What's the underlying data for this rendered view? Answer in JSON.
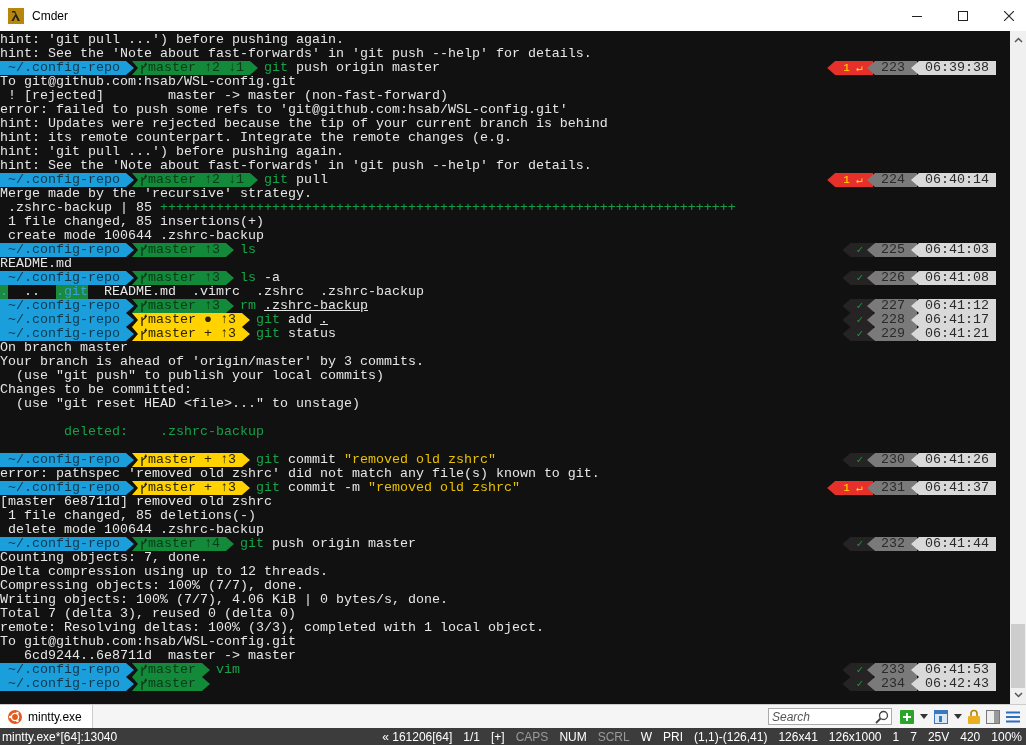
{
  "window": {
    "title": "Cmder"
  },
  "terminal": {
    "lines": [
      {
        "kind": "text",
        "parts": [
          {
            "text": "hint: 'git pull ...') before pushing again."
          }
        ]
      },
      {
        "kind": "text",
        "parts": [
          {
            "text": "hint: See the 'Note about fast-forwards' in 'git push --help' for details."
          }
        ]
      },
      {
        "kind": "prompt",
        "path": "~/.config-repo",
        "branch": "master ↑2 ↓1",
        "dirty": false,
        "command": [
          {
            "text": "git",
            "kind": "program"
          },
          {
            "text": "push origin master"
          }
        ],
        "status": {
          "kind": "error",
          "text": "1 ↵"
        },
        "number": "223",
        "time": "06:39:38"
      },
      {
        "kind": "text",
        "parts": [
          {
            "text": "To git@github.com:hsab/WSL-config.git"
          }
        ]
      },
      {
        "kind": "text",
        "parts": [
          {
            "text": " ! [rejected]        master -> master (non-fast-forward)"
          }
        ]
      },
      {
        "kind": "text",
        "parts": [
          {
            "text": "error: failed to push some refs to 'git@github.com:hsab/WSL-config.git'"
          }
        ]
      },
      {
        "kind": "text",
        "parts": [
          {
            "text": "hint: Updates were rejected because the tip of your current branch is behind"
          }
        ]
      },
      {
        "kind": "text",
        "parts": [
          {
            "text": "hint: its remote counterpart. Integrate the remote changes (e.g."
          }
        ]
      },
      {
        "kind": "text",
        "parts": [
          {
            "text": "hint: 'git pull ...') before pushing again."
          }
        ]
      },
      {
        "kind": "text",
        "parts": [
          {
            "text": "hint: See the 'Note about fast-forwards' in 'git push --help' for details."
          }
        ]
      },
      {
        "kind": "prompt",
        "path": "~/.config-repo",
        "branch": "master ↑2 ↓1",
        "dirty": false,
        "command": [
          {
            "text": "git",
            "kind": "program"
          },
          {
            "text": "pull"
          }
        ],
        "status": {
          "kind": "error",
          "text": "1 ↵"
        },
        "number": "224",
        "time": "06:40:14"
      },
      {
        "kind": "text",
        "parts": [
          {
            "text": "Merge made by the 'recursive' strategy."
          }
        ]
      },
      {
        "kind": "text",
        "parts": [
          {
            "text": " .zshrc-backup | 85 "
          },
          {
            "text": "++++++++++++++++++++++++++++++++++++++++++++++++++++++++++++++++++++++++",
            "kind": "added"
          }
        ]
      },
      {
        "kind": "text",
        "parts": [
          {
            "text": " 1 file changed, 85 insertions(+)"
          }
        ]
      },
      {
        "kind": "text",
        "parts": [
          {
            "text": " create mode 100644 .zshrc-backup"
          }
        ]
      },
      {
        "kind": "prompt",
        "path": "~/.config-repo",
        "branch": "master ↑3",
        "dirty": false,
        "command": [
          {
            "text": "ls",
            "kind": "program"
          }
        ],
        "status": {
          "kind": "ok",
          "text": "✓"
        },
        "number": "225",
        "time": "06:41:03"
      },
      {
        "kind": "text",
        "parts": [
          {
            "text": "README.md"
          }
        ]
      },
      {
        "kind": "prompt",
        "path": "~/.config-repo",
        "branch": "master ↑3",
        "dirty": false,
        "command": [
          {
            "text": "ls",
            "kind": "program"
          },
          {
            "text": "-a"
          }
        ],
        "status": {
          "kind": "ok",
          "text": "✓"
        },
        "number": "226",
        "time": "06:41:08"
      },
      {
        "kind": "text",
        "parts": [
          {
            "text": ".",
            "kind": "directory"
          },
          {
            "text": "  ..  "
          },
          {
            "text": ".git",
            "kind": "directory"
          },
          {
            "text": "  README.md  .vimrc  .zshrc  .zshrc-backup"
          }
        ]
      },
      {
        "kind": "prompt",
        "path": "~/.config-repo",
        "branch": "master ↑3",
        "dirty": false,
        "command": [
          {
            "text": "rm",
            "kind": "program"
          },
          {
            "text": ".zshrc-backup",
            "kind": "path"
          }
        ],
        "status": {
          "kind": "ok",
          "text": "✓"
        },
        "number": "227",
        "time": "06:41:12"
      },
      {
        "kind": "prompt",
        "path": "~/.config-repo",
        "branch": "master ● ↑3",
        "dirty": true,
        "command": [
          {
            "text": "git",
            "kind": "program"
          },
          {
            "text": "add "
          },
          {
            "text": ".",
            "kind": "path"
          }
        ],
        "status": {
          "kind": "ok",
          "text": "✓"
        },
        "number": "228",
        "time": "06:41:17"
      },
      {
        "kind": "prompt",
        "path": "~/.config-repo",
        "branch": "master + ↑3",
        "dirty": true,
        "command": [
          {
            "text": "git",
            "kind": "program"
          },
          {
            "text": "status"
          }
        ],
        "status": {
          "kind": "ok",
          "text": "✓"
        },
        "number": "229",
        "time": "06:41:21"
      },
      {
        "kind": "text",
        "parts": [
          {
            "text": "On branch master"
          }
        ]
      },
      {
        "kind": "text",
        "parts": [
          {
            "text": "Your branch is ahead of 'origin/master' by 3 commits."
          }
        ]
      },
      {
        "kind": "text",
        "parts": [
          {
            "text": "  (use \"git push\" to publish your local commits)"
          }
        ]
      },
      {
        "kind": "text",
        "parts": [
          {
            "text": "Changes to be committed:"
          }
        ]
      },
      {
        "kind": "text",
        "parts": [
          {
            "text": "  (use \"git reset HEAD <file>...\" to unstage)"
          }
        ]
      },
      {
        "kind": "blank"
      },
      {
        "kind": "text",
        "parts": [
          {
            "text": "        deleted:    .zshrc-backup",
            "kind": "added"
          }
        ]
      },
      {
        "kind": "blank"
      },
      {
        "kind": "prompt",
        "path": "~/.config-repo",
        "branch": "master + ↑3",
        "dirty": true,
        "command": [
          {
            "text": "git",
            "kind": "program"
          },
          {
            "text": "commit "
          },
          {
            "text": "\"removed old zshrc\"",
            "kind": "quoted"
          }
        ],
        "status": {
          "kind": "ok",
          "text": "✓"
        },
        "number": "230",
        "time": "06:41:26"
      },
      {
        "kind": "text",
        "parts": [
          {
            "text": "error: pathspec 'removed old zshrc' did not match any file(s) known to git."
          }
        ]
      },
      {
        "kind": "prompt",
        "path": "~/.config-repo",
        "branch": "master + ↑3",
        "dirty": true,
        "command": [
          {
            "text": "git",
            "kind": "program"
          },
          {
            "text": "commit -m "
          },
          {
            "text": "\"removed old zshrc\"",
            "kind": "quoted"
          }
        ],
        "status": {
          "kind": "error",
          "text": "1 ↵"
        },
        "number": "231",
        "time": "06:41:37"
      },
      {
        "kind": "text",
        "parts": [
          {
            "text": "[master 6e8711d] removed old zshrc"
          }
        ]
      },
      {
        "kind": "text",
        "parts": [
          {
            "text": " 1 file changed, 85 deletions(-)"
          }
        ]
      },
      {
        "kind": "text",
        "parts": [
          {
            "text": " delete mode 100644 .zshrc-backup"
          }
        ]
      },
      {
        "kind": "prompt",
        "path": "~/.config-repo",
        "branch": "master ↑4",
        "dirty": false,
        "command": [
          {
            "text": "git",
            "kind": "program"
          },
          {
            "text": "push origin master"
          }
        ],
        "status": {
          "kind": "ok",
          "text": "✓"
        },
        "number": "232",
        "time": "06:41:44"
      },
      {
        "kind": "text",
        "parts": [
          {
            "text": "Counting objects: 7, done."
          }
        ]
      },
      {
        "kind": "text",
        "parts": [
          {
            "text": "Delta compression using up to 12 threads."
          }
        ]
      },
      {
        "kind": "text",
        "parts": [
          {
            "text": "Compressing objects: 100% (7/7), done."
          }
        ]
      },
      {
        "kind": "text",
        "parts": [
          {
            "text": "Writing objects: 100% (7/7), 4.06 KiB | 0 bytes/s, done."
          }
        ]
      },
      {
        "kind": "text",
        "parts": [
          {
            "text": "Total 7 (delta 3), reused 0 (delta 0)"
          }
        ]
      },
      {
        "kind": "text",
        "parts": [
          {
            "text": "remote: Resolving deltas: 100% (3/3), completed with 1 local object."
          }
        ]
      },
      {
        "kind": "text",
        "parts": [
          {
            "text": "To git@github.com:hsab/WSL-config.git"
          }
        ]
      },
      {
        "kind": "text",
        "parts": [
          {
            "text": "   6cd9244..6e8711d  master -> master"
          }
        ]
      },
      {
        "kind": "prompt",
        "path": "~/.config-repo",
        "branch": "master",
        "dirty": false,
        "command": [
          {
            "text": "vim",
            "kind": "program"
          }
        ],
        "status": {
          "kind": "ok",
          "text": "✓"
        },
        "number": "233",
        "time": "06:41:53"
      },
      {
        "kind": "prompt",
        "path": "~/.config-repo",
        "branch": "master",
        "dirty": false,
        "status": {
          "kind": "ok",
          "text": "✓"
        },
        "number": "234",
        "time": "06:42:43"
      }
    ]
  },
  "tabs": [
    {
      "label": "mintty.exe",
      "selected": true
    }
  ],
  "search": {
    "placeholder": "Search"
  },
  "status_bar": {
    "process": "mintty.exe*[64]:13040",
    "items": [
      {
        "text": "« 161206[64]",
        "disabled": false
      },
      {
        "text": "1/1",
        "disabled": false
      },
      {
        "text": "[+]",
        "disabled": false
      },
      {
        "text": "CAPS",
        "disabled": true
      },
      {
        "text": "NUM",
        "disabled": false
      },
      {
        "text": "SCRL",
        "disabled": true
      },
      {
        "text": "W",
        "disabled": false
      },
      {
        "text": "PRI",
        "disabled": false
      },
      {
        "text": "(1,1)-(126,41)",
        "disabled": false
      },
      {
        "text": "126x41",
        "disabled": false
      },
      {
        "text": "126x1000",
        "disabled": false
      },
      {
        "text": "1",
        "disabled": false
      },
      {
        "text": "7",
        "disabled": false
      },
      {
        "text": "25V",
        "disabled": false
      },
      {
        "text": "420",
        "disabled": false
      },
      {
        "text": "100%",
        "disabled": false
      }
    ]
  }
}
